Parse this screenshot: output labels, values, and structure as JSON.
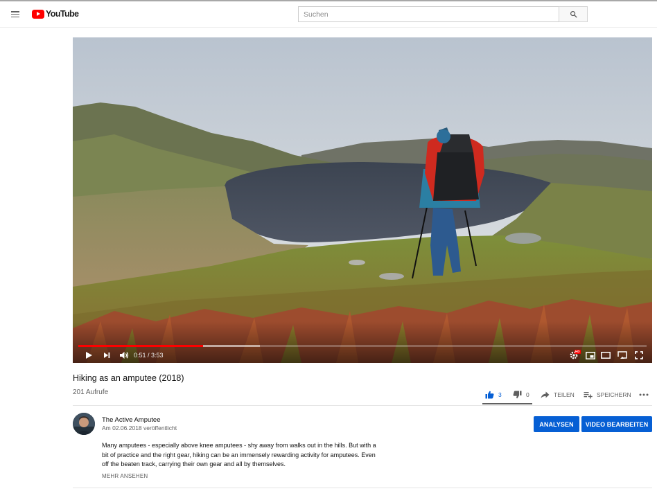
{
  "header": {
    "logo_text": "YouTube",
    "search_placeholder": "Suchen"
  },
  "player": {
    "time_current": "0:51",
    "time_separator": " / ",
    "time_total": "3:53",
    "progress_played": 0.22,
    "progress_buffered": 0.32,
    "accent_color": "#ff0000",
    "settings_badge": "HD"
  },
  "video": {
    "title": "Hiking as an amputee (2018)",
    "views": "201 Aufrufe",
    "likes": "3",
    "dislikes": "0",
    "share_label": "TEILEN",
    "save_label": "SPEICHERN"
  },
  "channel": {
    "name": "The Active Amputee",
    "published": "Am 02.06.2018 veröffentlicht",
    "analytics_button": "ANALYSEN",
    "edit_button": "VIDEO BEARBEITEN",
    "button_color": "#065fd4"
  },
  "description": {
    "lines": [
      "Many amputees - especially above knee amputees - shy away from walks out in the hills. But with a",
      "bit of practice and the right gear, hiking can be an immensely rewarding activity for amputees. Even",
      "off the beaten track, carrying their own gear and all by themselves."
    ],
    "show_more": "MEHR ANSEHEN"
  }
}
